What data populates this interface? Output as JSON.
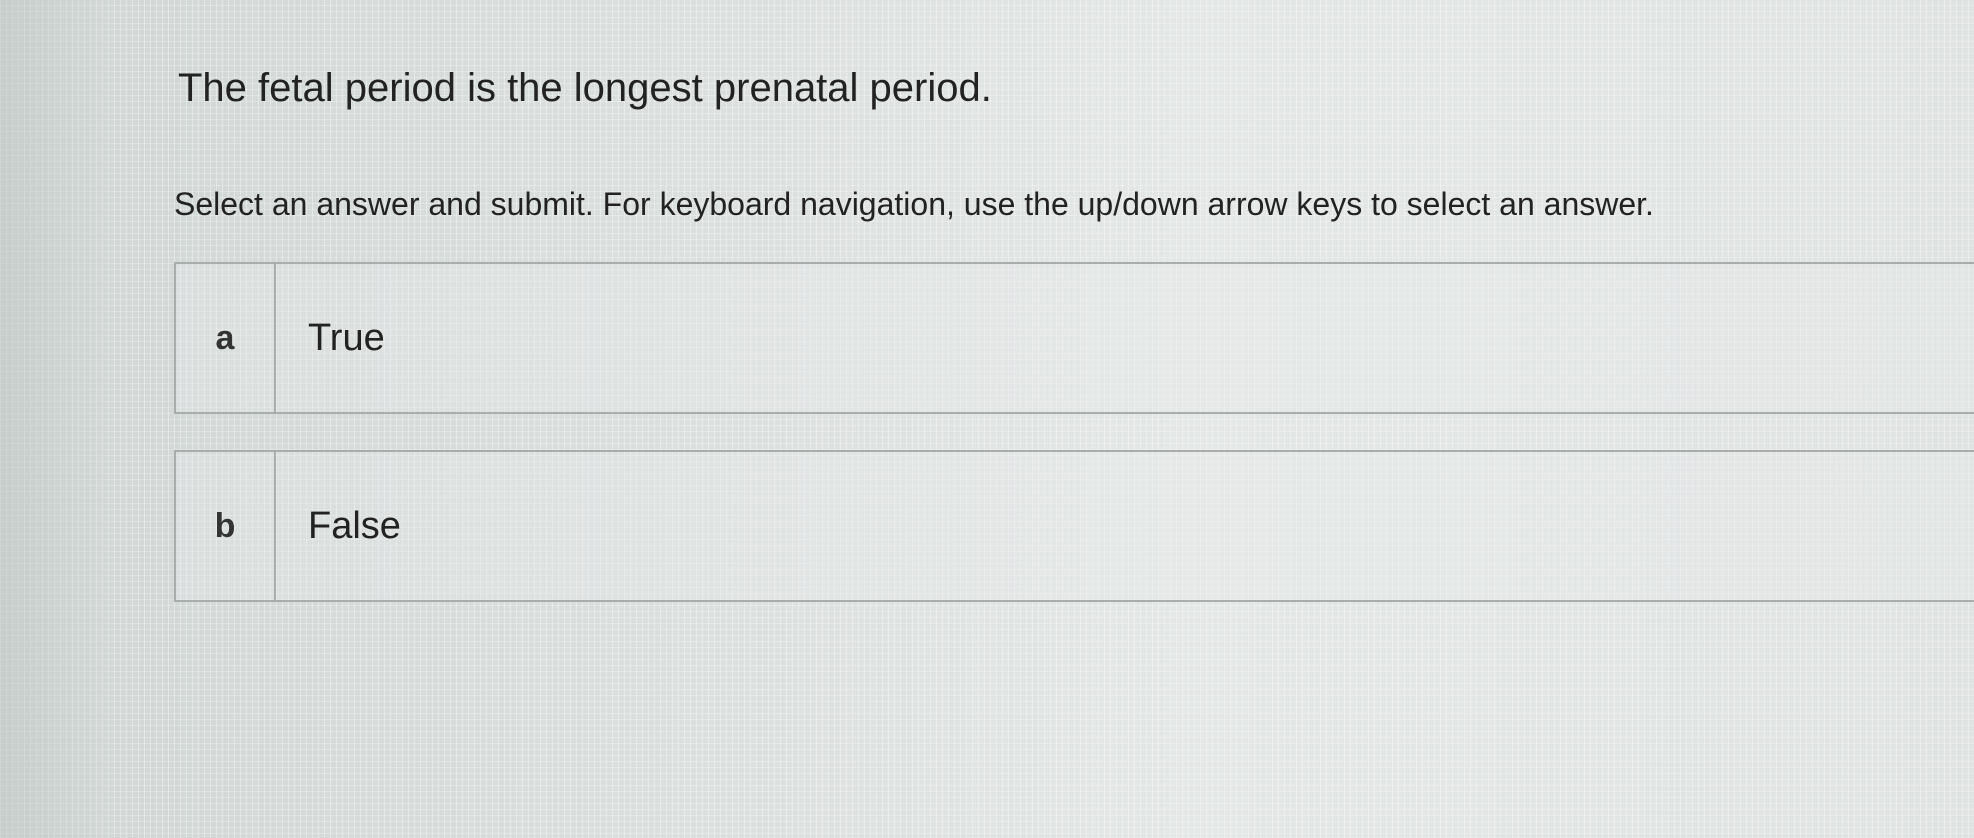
{
  "question": {
    "title": "The fetal period is the longest prenatal period.",
    "instructions": "Select an answer and submit. For keyboard navigation, use the up/down arrow keys to select an answer."
  },
  "options": [
    {
      "letter": "a",
      "label": "True"
    },
    {
      "letter": "b",
      "label": "False"
    }
  ]
}
